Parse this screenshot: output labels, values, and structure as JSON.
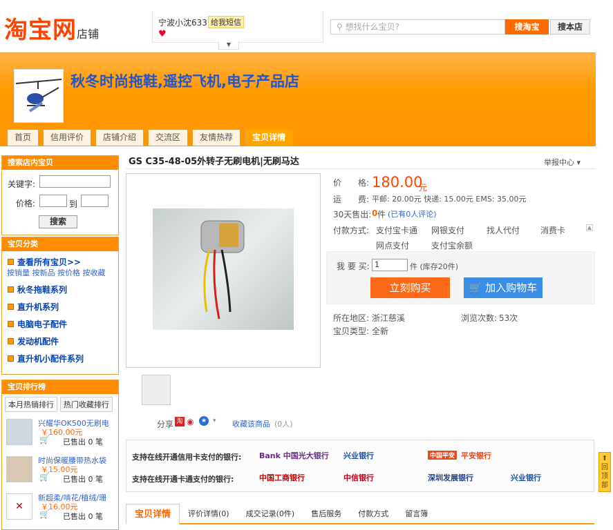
{
  "header": {
    "logo_main": "淘宝网",
    "logo_sub": "店铺",
    "seller_name": "宁波小沈633",
    "message_label": "给我短信",
    "search_placeholder": "想找什么宝贝?",
    "search_taobao": "搜淘宝",
    "search_store": "搜本店"
  },
  "shop": {
    "name": "秋冬时尚拖鞋,遥控飞机,电子产品店",
    "nav": [
      "首页",
      "信用评价",
      "店铺介绍",
      "交流区",
      "友情热荐",
      "宝贝详情"
    ]
  },
  "sidebar": {
    "search_title": "搜索店内宝贝",
    "keyword_label": "关键字:",
    "price_label": "价格:",
    "to_label": "到",
    "search_button": "搜索",
    "category_title": "宝贝分类",
    "all_items": "查看所有宝贝>>",
    "sort_links": [
      "按销量",
      "按新品",
      "按价格",
      "按收藏"
    ],
    "categories": [
      "秋冬拖鞋系列",
      "直升机系列",
      "电脑电子配件",
      "发动机配件",
      "直升机小配件系列"
    ],
    "rank_title": "宝贝排行榜",
    "rank_tabs": [
      "本月热销排行",
      "热门收藏排行"
    ],
    "rank_items": [
      {
        "name": "兴耀华OK500无刷电",
        "price": "￥160.00元",
        "sold": "已售出 0 笔"
      },
      {
        "name": "时尚保暖腰带热水袋",
        "price": "￥15.00元",
        "sold": "已售出 0 笔"
      },
      {
        "name": "新超柔/啃花/植绒/珊",
        "price": "￥16.00元",
        "sold": "已售出 0 笔"
      }
    ]
  },
  "product": {
    "title": "GS C35-48-05外转子无刷电机|无刷马达",
    "report": "举报中心",
    "price_label": "价　　格:",
    "price": "180.00",
    "price_unit": "元",
    "shipping_label": "运　　费:",
    "shipping": "平邮: 20.00元 快递: 15.00元 EMS: 35.00元",
    "sold_label": "30天售出:",
    "sold_count": "0",
    "sold_unit": "件",
    "review_link": "(已有0人评论)",
    "payment_label": "付款方式:",
    "payments": [
      "支付宝卡通",
      "网银支付",
      "找人代付",
      "消费卡",
      "网点支付",
      "支付宝余额"
    ],
    "buy_label": "我 要 买:",
    "quantity": "1",
    "stock": "件 (库存20件)",
    "buy_now": "立刻购买",
    "add_cart": "加入购物车",
    "location_label": "所在地区:",
    "location": "浙江慈溪",
    "views_label": "浏览次数:",
    "views": "53次",
    "type_label": "宝贝类型:",
    "type": "全新",
    "share": "分享",
    "favorite": "收藏该商品",
    "favorite_count": "(0人)"
  },
  "banks": {
    "credit_label": "支持在线开通信用卡支付的银行:",
    "debit_label": "支持在线开通卡通支付的银行:",
    "credit_banks": [
      "Bank 中国光大银行",
      "兴业银行",
      "中国平安",
      "平安银行"
    ],
    "debit_banks": [
      "中国工商银行",
      "中信银行",
      "深圳发展银行",
      "兴业银行"
    ]
  },
  "detail_tabs": [
    "宝贝详情",
    "评价详情(0)",
    "成交记录(0件)",
    "售后服务",
    "付款方式",
    "留言簿"
  ],
  "backtop": "回顶部",
  "colors": {
    "brand": "#ff4400",
    "banner": "#ff9a00",
    "link": "#3366cc"
  }
}
